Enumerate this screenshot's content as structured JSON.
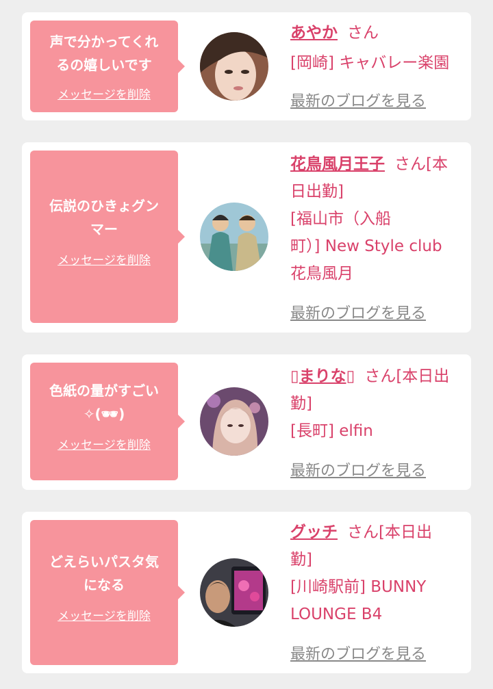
{
  "delete_label": "メッセージを削除",
  "blog_label": "最新のブログを見る",
  "colors": {
    "bubble": "#f7949c",
    "accent": "#d9416a",
    "link_gray": "#888888",
    "background": "#eeeeee"
  },
  "items": [
    {
      "message_lines": [
        "声で分かってくれ",
        "るの嬉しいです"
      ],
      "name": "あやか",
      "suffix": "さん",
      "shop_lines": [
        "[岡崎] キャバレー楽園"
      ]
    },
    {
      "message_lines": [
        "伝説のひきょグン",
        "マー"
      ],
      "name": "花鳥風月王子",
      "suffix": "さん[本",
      "shop_lines": [
        "日出勤]",
        "[福山市（入船",
        "町）] New Style club",
        "花鳥風月"
      ]
    },
    {
      "message_lines": [
        "色紙の量がすごい",
        "✧(🕶)"
      ],
      "name": "▯まりな▯",
      "suffix": "さん[本日出",
      "shop_lines": [
        "勤]",
        "[長町] elfin"
      ]
    },
    {
      "message_lines": [
        "どえらいパスタ気",
        "になる"
      ],
      "name": "グッチ",
      "suffix": "さん[本日出",
      "shop_lines": [
        "勤]",
        "[川崎駅前] BUNNY",
        "LOUNGE B4"
      ]
    }
  ]
}
